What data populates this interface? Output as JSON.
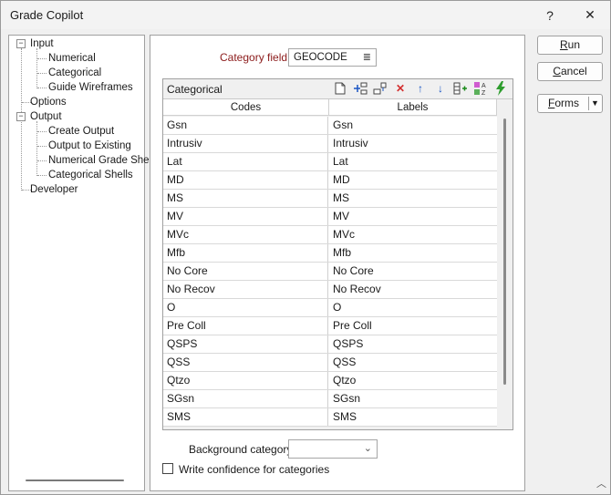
{
  "window": {
    "title": "Grade Copilot",
    "help_glyph": "?",
    "close_glyph": "✕"
  },
  "tree": {
    "items": [
      {
        "label": "Input"
      },
      {
        "label": "Numerical"
      },
      {
        "label": "Categorical"
      },
      {
        "label": "Guide Wireframes"
      },
      {
        "label": "Options"
      },
      {
        "label": "Output"
      },
      {
        "label": "Create Output"
      },
      {
        "label": "Output to Existing"
      },
      {
        "label": "Numerical Grade Shell"
      },
      {
        "label": "Categorical Shells"
      },
      {
        "label": "Developer"
      }
    ],
    "expander_glyph": "−"
  },
  "category_field": {
    "label": "Category field",
    "value": "GEOCODE",
    "icon": "list-icon"
  },
  "grid": {
    "title": "Categorical",
    "toolbar": [
      {
        "icon": "new-file-icon",
        "glyph": "🗋"
      },
      {
        "icon": "insert-before-icon",
        "glyph": "⇄"
      },
      {
        "icon": "insert-after-icon",
        "glyph": "⊟"
      },
      {
        "icon": "delete-icon",
        "glyph": "✕"
      },
      {
        "icon": "move-up-icon",
        "glyph": "↑"
      },
      {
        "icon": "move-down-icon",
        "glyph": "↓"
      },
      {
        "icon": "add-rows-icon",
        "glyph": "⊞"
      },
      {
        "icon": "sort-az-icon",
        "glyph": "AZ"
      },
      {
        "icon": "lightning-icon",
        "glyph": "⚡"
      }
    ],
    "columns": [
      "Codes",
      "Labels"
    ],
    "rows": [
      [
        "Gsn",
        "Gsn"
      ],
      [
        "Intrusiv",
        "Intrusiv"
      ],
      [
        "Lat",
        "Lat"
      ],
      [
        "MD",
        "MD"
      ],
      [
        "MS",
        "MS"
      ],
      [
        "MV",
        "MV"
      ],
      [
        "MVc",
        "MVc"
      ],
      [
        "Mfb",
        "Mfb"
      ],
      [
        "No Core",
        "No Core"
      ],
      [
        "No Recov",
        "No Recov"
      ],
      [
        "O",
        "O"
      ],
      [
        "Pre Coll",
        "Pre Coll"
      ],
      [
        "QSPS",
        "QSPS"
      ],
      [
        "QSS",
        "QSS"
      ],
      [
        "Qtzo",
        "Qtzo"
      ],
      [
        "SGsn",
        "SGsn"
      ],
      [
        "SMS",
        "SMS"
      ]
    ]
  },
  "background_category": {
    "label": "Background category",
    "value": "",
    "chevron": "⌄"
  },
  "write_confidence": {
    "label": "Write confidence for categories",
    "checked": false
  },
  "buttons": {
    "run": {
      "underline": "R",
      "rest": "un"
    },
    "cancel": {
      "underline": "C",
      "rest": "ancel"
    },
    "forms": {
      "underline": "F",
      "rest": "orms",
      "arrow": "▼"
    }
  },
  "colors": {
    "accent_label": "#8b1a1a",
    "lightning": "#2e9d2e",
    "delete": "#d32f2f",
    "arrows": "#1a56c4"
  }
}
